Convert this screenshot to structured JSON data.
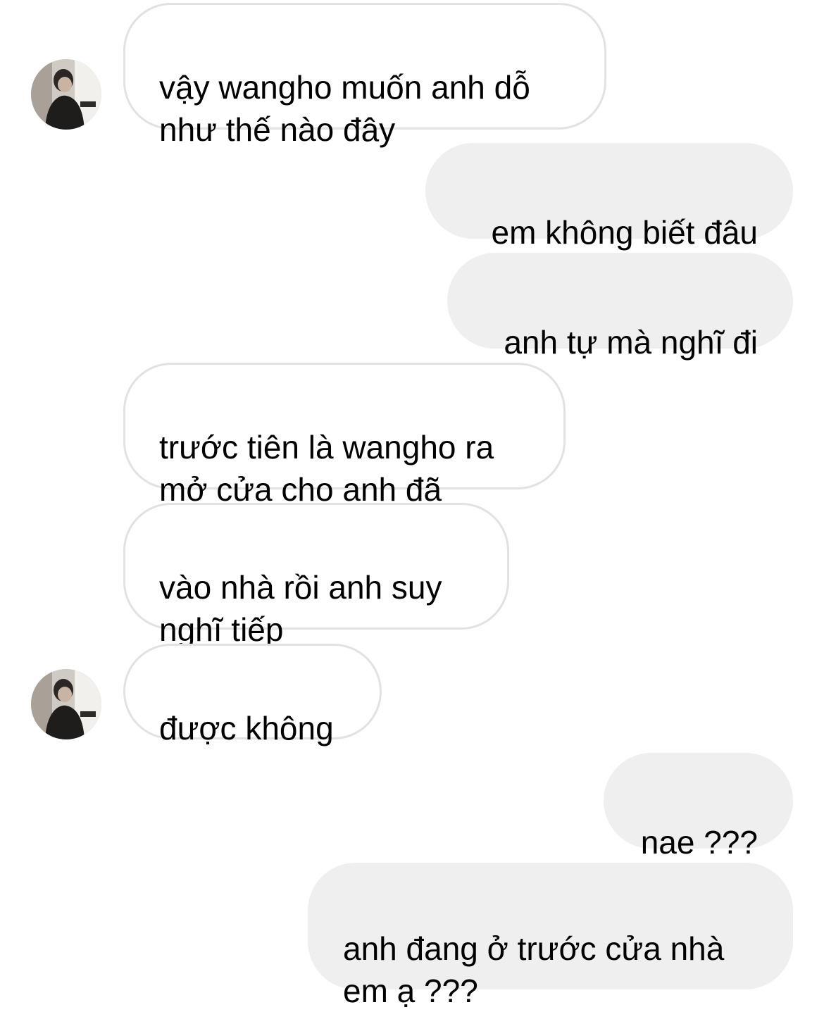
{
  "conversation": {
    "messages": [
      {
        "sender": "other",
        "text": "vậy wangho muốn anh dỗ\nnhư thế nào đây"
      },
      {
        "sender": "me",
        "text": "em không biết đâu"
      },
      {
        "sender": "me",
        "text": "anh tự mà nghĩ đi"
      },
      {
        "sender": "other",
        "text": "trước tiên là wangho ra\nmở cửa cho anh đã"
      },
      {
        "sender": "other",
        "text": "vào nhà rồi anh suy\nnghĩ tiếp"
      },
      {
        "sender": "other",
        "text": "được không"
      },
      {
        "sender": "me",
        "text": "nae ???"
      },
      {
        "sender": "me",
        "text": "anh đang ở trước cửa nhà\nem ạ ???"
      }
    ]
  },
  "colors": {
    "incoming_bubble_bg": "#ffffff",
    "incoming_bubble_border": "#e2e2e2",
    "outgoing_bubble_bg": "#efefef",
    "text": "#000000"
  },
  "icons": {
    "avatar": "contact-avatar-photo"
  }
}
